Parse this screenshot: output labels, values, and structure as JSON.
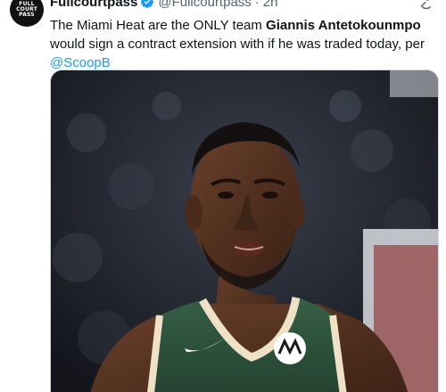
{
  "author": {
    "display_name": "Fullcourtpass",
    "handle": "@Fullcourtpass",
    "separator": "·",
    "time": "2h",
    "avatar_text": [
      "FULL",
      "COURT",
      "PASS"
    ],
    "verified_color": "#1d9bf0"
  },
  "tweet": {
    "text_part1": "The Miami Heat are the ONLY team ",
    "text_bold": "Giannis Antetokounmpo",
    "text_part2": " would sign a contract extension with if he was traded today, per ",
    "mention": "@ScoopB"
  },
  "media": {
    "description_icon": "photo",
    "jersey_color": "#2c5a3d",
    "trim_color": "#eee1c6"
  },
  "colors": {
    "text": "#0f1419",
    "muted": "#536471",
    "link": "#1d9bf0"
  }
}
